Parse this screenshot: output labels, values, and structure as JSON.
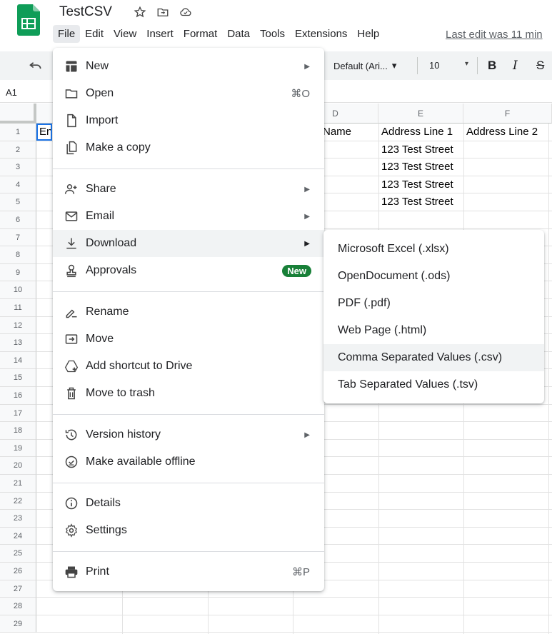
{
  "doc": {
    "title": "TestCSV",
    "last_edit": "Last edit was 11 min"
  },
  "menubar": [
    "File",
    "Edit",
    "View",
    "Insert",
    "Format",
    "Data",
    "Tools",
    "Extensions",
    "Help"
  ],
  "toolbar": {
    "font": "Default (Ari...",
    "font_size": "10",
    "bold": "B",
    "italic": "I",
    "strike": "S"
  },
  "namebox": "A1",
  "columns": [
    "D",
    "E",
    "F"
  ],
  "rows": [
    "1",
    "2",
    "3",
    "4",
    "5",
    "6",
    "7",
    "8",
    "9",
    "10",
    "11",
    "12",
    "13",
    "14",
    "15",
    "16",
    "17",
    "18",
    "19",
    "20",
    "21",
    "22",
    "23",
    "24",
    "25",
    "26",
    "27",
    "28",
    "29"
  ],
  "cells": {
    "a1": "En",
    "d1": "Name",
    "e1": "Address Line 1",
    "f1": "Address Line 2",
    "e2": "123 Test Street",
    "e3": "123 Test Street",
    "e4": "123 Test Street",
    "e5": "123 Test Street"
  },
  "file_menu": {
    "new": "New",
    "open": "Open",
    "open_shortcut": "⌘O",
    "import": "Import",
    "make_copy": "Make a copy",
    "share": "Share",
    "email": "Email",
    "download": "Download",
    "approvals": "Approvals",
    "approvals_badge": "New",
    "rename": "Rename",
    "move": "Move",
    "add_shortcut": "Add shortcut to Drive",
    "move_trash": "Move to trash",
    "version_history": "Version history",
    "offline": "Make available offline",
    "details": "Details",
    "settings": "Settings",
    "print": "Print",
    "print_shortcut": "⌘P"
  },
  "download_menu": [
    "Microsoft Excel (.xlsx)",
    "OpenDocument (.ods)",
    "PDF (.pdf)",
    "Web Page (.html)",
    "Comma Separated Values (.csv)",
    "Tab Separated Values (.tsv)"
  ],
  "colors": {
    "accent": "#1a73e8",
    "sheets_green": "#0f9d58",
    "badge_green": "#188038",
    "highlight": "#f1f3f4"
  }
}
